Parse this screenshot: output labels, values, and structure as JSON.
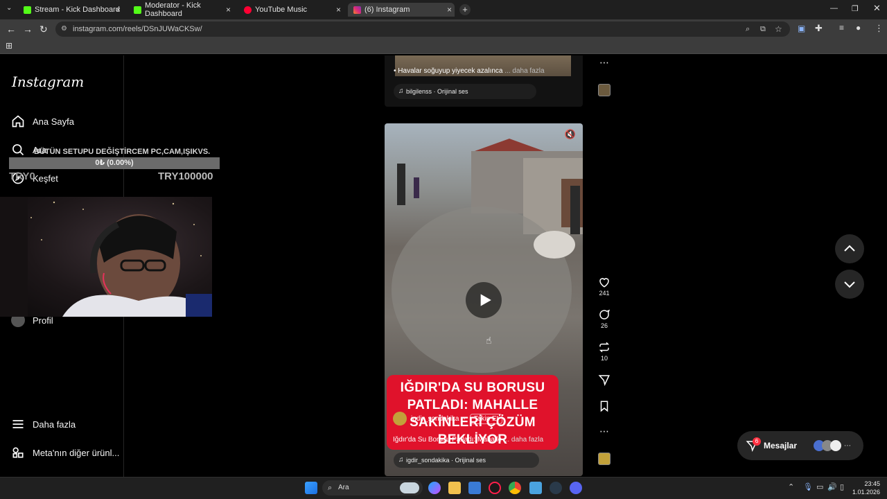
{
  "browser": {
    "tabs": [
      {
        "title": "Stream - Kick Dashboard",
        "favicon_color": "#53fc18"
      },
      {
        "title": "Moderator - Kick Dashboard",
        "favicon_color": "#53fc18"
      },
      {
        "title": "YouTube Music",
        "favicon_color": "#ff0033"
      },
      {
        "title": "(6) Instagram",
        "favicon_color": "#e1306c"
      }
    ],
    "url": "instagram.com/reels/DSnJUWaCKSw/"
  },
  "instagram": {
    "logo": "Instagram",
    "nav": {
      "home": "Ana Sayfa",
      "search": "Ara",
      "explore": "Keşfet",
      "profile": "Profil",
      "more": "Daha fazla",
      "meta": "Meta'nın diğer ürünl..."
    },
    "prev_reel": {
      "caption": "Havalar soğuyup yiyecek azalınca",
      "more": "... daha fazla",
      "audio": "bilgilenss · Orijinal ses"
    },
    "reel": {
      "headline": "IĞDIR'DA SU BORUSU PATLADI: MAHALLE SAKİNLERİ ÇÖZÜM BEKLİYOR",
      "username": "igdir_sondakika",
      "follow": "Takip Et",
      "caption": "Iğdır'da Su Borusu Patladı: Mahalle",
      "more": "... daha fazla",
      "audio": "igdir_sondakika · Orijinal ses"
    },
    "actions": {
      "likes": "241",
      "comments": "26",
      "reposts": "10"
    },
    "messages": {
      "label": "Mesajlar",
      "badge": "6"
    }
  },
  "overlay": {
    "goal_title": "BÜTÜN SETUPU DEĞİŞTİRCEM PC,CAM,IŞIKVS.",
    "goal_progress_text": "0₺ (0.00%)",
    "goal_progress": 0,
    "goal_start": "TRY0",
    "goal_target": "TRY100000"
  },
  "taskbar": {
    "search": "Ara",
    "time": "23:45",
    "date": "1.01.2026"
  },
  "colors": {
    "accent_kick": "#53fc18",
    "headline_red": "#e0122b"
  }
}
